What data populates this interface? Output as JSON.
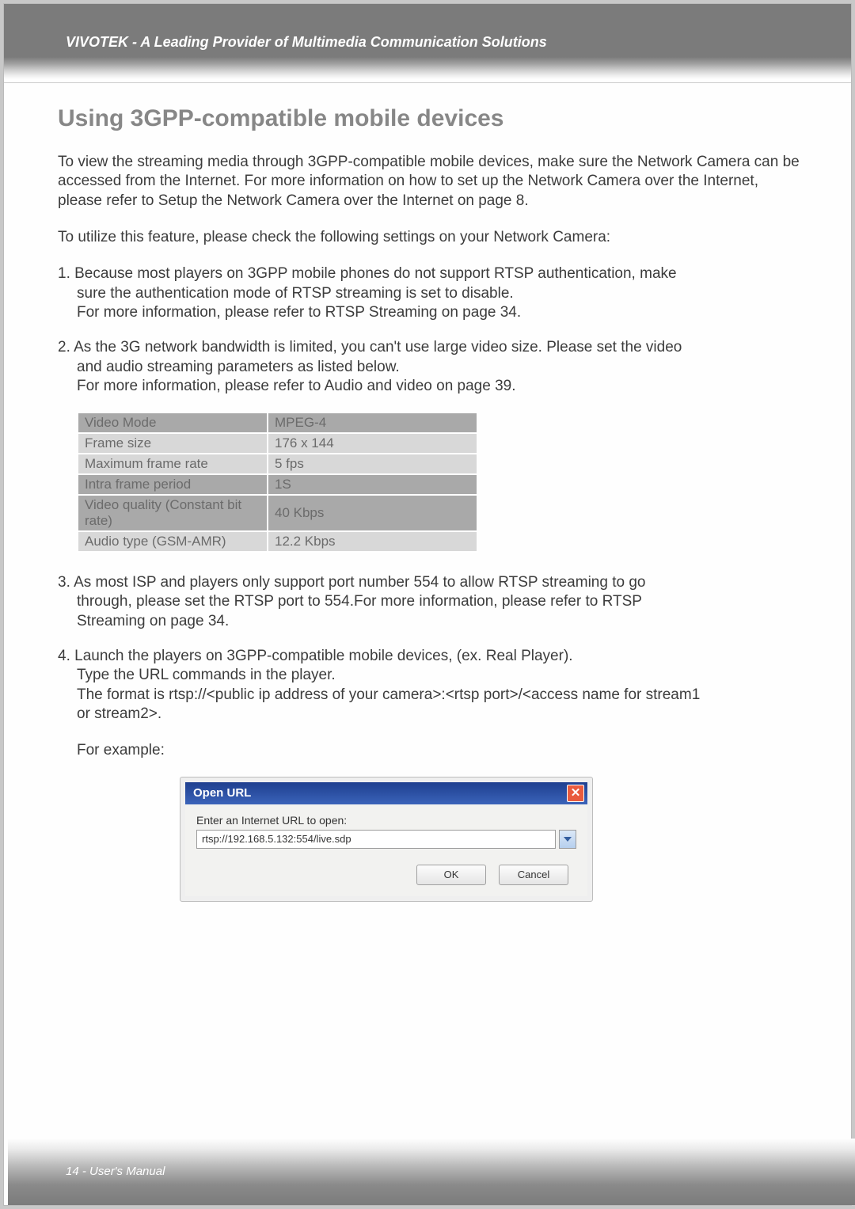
{
  "header": {
    "brand": "VIVOTEK - A Leading Provider of Multimedia Communication Solutions"
  },
  "section_title": "Using 3GPP-compatible mobile devices",
  "intro_para": "To view the streaming media through 3GPP-compatible mobile devices, make sure the Network Camera can be accessed from the Internet. For more information on how to set up the Network Camera over the Internet, please refer to Setup the Network Camera over the Internet on page 8.",
  "feature_intro": "To utilize this feature, please check the following settings on your Network Camera:",
  "item1": {
    "line1": "1. Because most players on 3GPP mobile phones do not support RTSP authentication, make",
    "line2": "sure the authentication mode of RTSP streaming is set to disable.",
    "line3": "For more information, please refer to RTSP Streaming on page 34."
  },
  "item2": {
    "line1": "2. As the 3G network bandwidth is limited, you can't use large video size. Please set the video",
    "line2": "and audio streaming parameters as listed below.",
    "line3": "For more information, please refer to Audio and video on page 39."
  },
  "settings_rows": [
    {
      "label": "Video Mode",
      "value": "MPEG-4"
    },
    {
      "label": "Frame size",
      "value": "176 x 144"
    },
    {
      "label": "Maximum frame rate",
      "value": "5 fps"
    },
    {
      "label": "Intra frame period",
      "value": "1S"
    },
    {
      "label": "Video quality (Constant bit rate)",
      "value": "40 Kbps"
    },
    {
      "label": "Audio type (GSM-AMR)",
      "value": "12.2 Kbps"
    }
  ],
  "item3": {
    "line1": "3. As most ISP and players only support port number 554 to allow RTSP streaming to go",
    "line2": "through, please set the RTSP port to 554.For more information, please refer to RTSP",
    "line3": "Streaming on page 34."
  },
  "item4": {
    "line1": "4. Launch the players on 3GPP-compatible mobile devices, (ex. Real Player).",
    "line2": "Type the URL commands in the player.",
    "line3": "The format is rtsp://<public ip address of your camera>:<rtsp port>/<access name for stream1",
    "line4": "or stream2>.",
    "example_label": "For example:"
  },
  "dialog": {
    "title": "Open URL",
    "label": "Enter an Internet URL to open:",
    "url_value": "rtsp://192.168.5.132:554/live.sdp",
    "ok_label": "OK",
    "cancel_label": "Cancel",
    "close_glyph": "✕"
  },
  "footer": {
    "text": "14 - User's Manual"
  }
}
